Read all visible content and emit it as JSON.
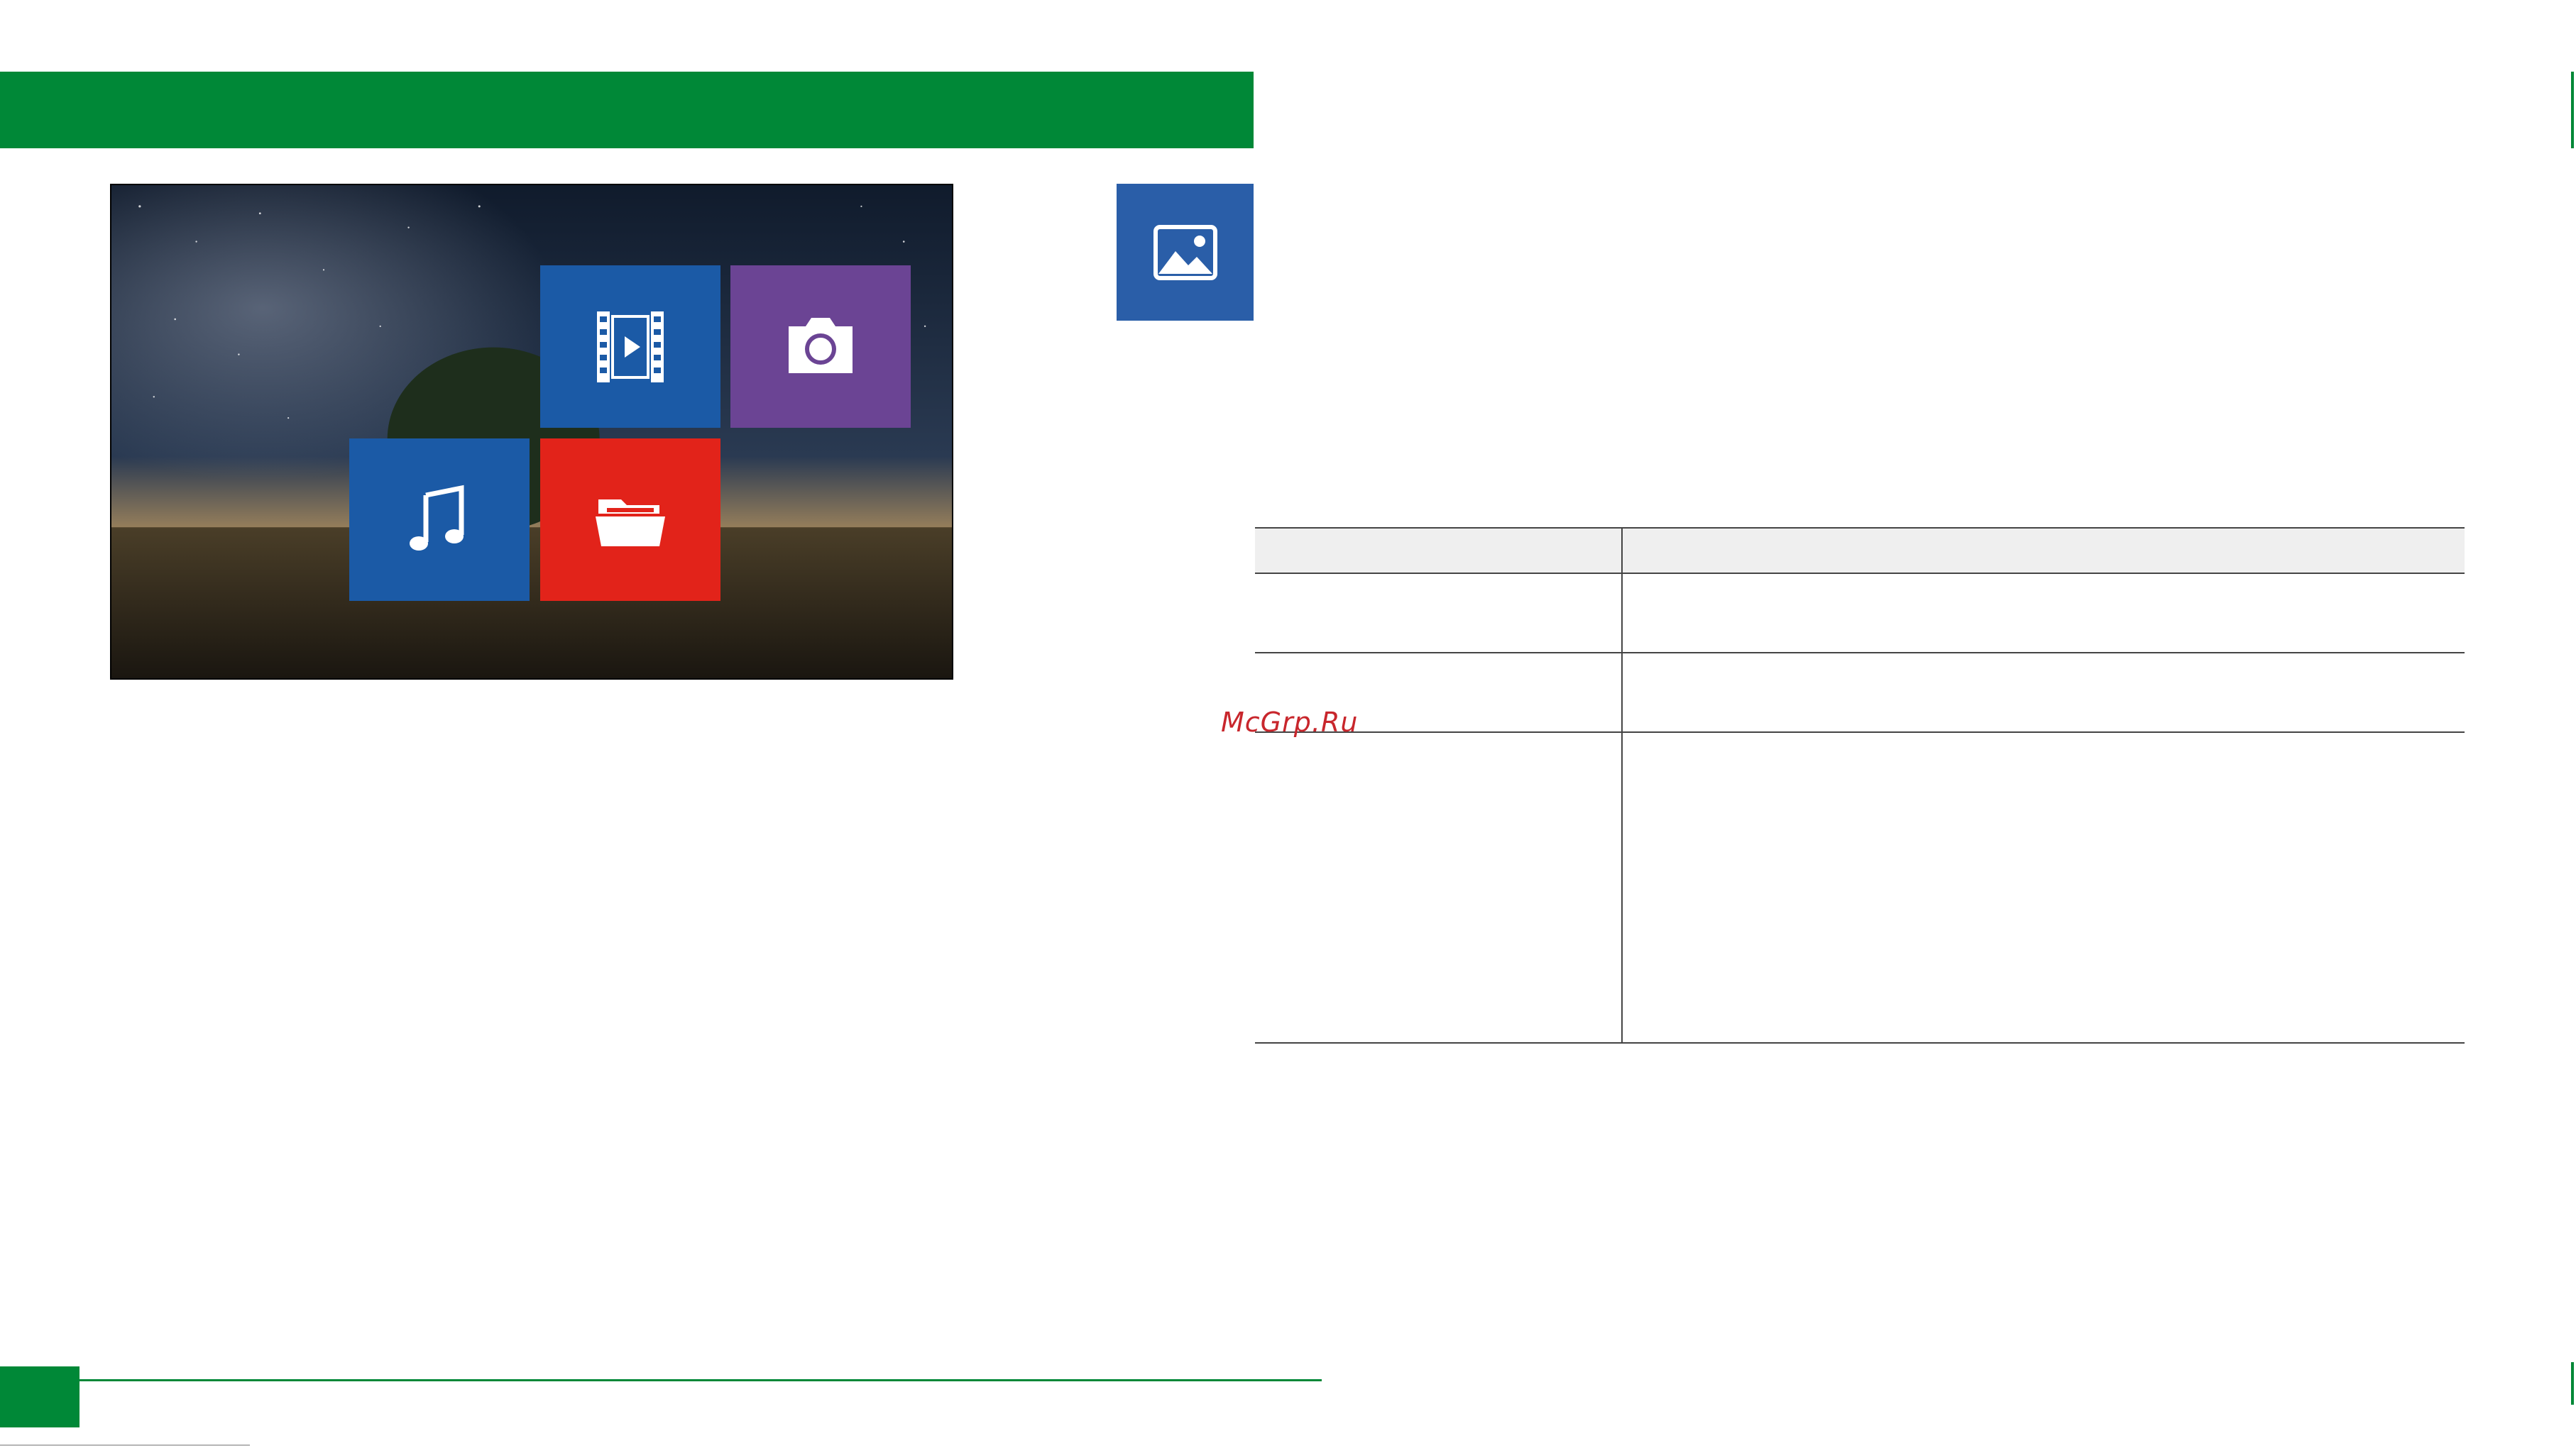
{
  "colors": {
    "header_bar": "#008837",
    "video_tile": "#1b5aa6",
    "camera_tile": "#6b4494",
    "music_tile": "#1b5aa6",
    "folder_tile": "#e2231a",
    "image_icon_box": "#2a5ea8",
    "watermark": "#c8262c"
  },
  "media_menu": {
    "tiles": [
      {
        "name": "video",
        "icon": "film-play-icon"
      },
      {
        "name": "photo",
        "icon": "camera-icon"
      },
      {
        "name": "music",
        "icon": "music-note-icon"
      },
      {
        "name": "files",
        "icon": "folder-open-icon"
      }
    ]
  },
  "section_icon": "image-icon",
  "table": {
    "header": [
      "",
      ""
    ],
    "rows": [
      [
        "",
        ""
      ],
      [
        "",
        ""
      ],
      [
        "",
        ""
      ]
    ]
  },
  "watermark": "McGrp.Ru"
}
